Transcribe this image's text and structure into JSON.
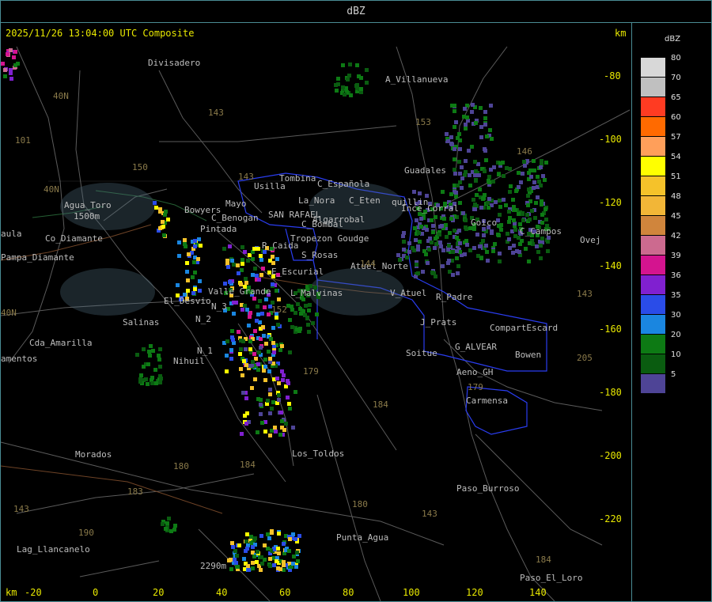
{
  "header": {
    "unit_title": "dBZ",
    "timestamp": "2025/11/26 13:04:00 UTC Composite",
    "km_top": "km",
    "km_bottom": "km"
  },
  "axes": {
    "x_ticks": [
      "-20",
      "0",
      "20",
      "40",
      "60",
      "80",
      "100",
      "120",
      "140"
    ],
    "y_ticks": [
      "-80",
      "-100",
      "-120",
      "-140",
      "-160",
      "-180",
      "-200",
      "-220"
    ]
  },
  "legend": {
    "title": "dBZ",
    "levels": [
      {
        "value": "80",
        "color": "#d8d8d8"
      },
      {
        "value": "70",
        "color": "#c0c0c0"
      },
      {
        "value": "65",
        "color": "#ff3b22"
      },
      {
        "value": "60",
        "color": "#ff6a00"
      },
      {
        "value": "57",
        "color": "#ff9f5a"
      },
      {
        "value": "54",
        "color": "#ffff00"
      },
      {
        "value": "51",
        "color": "#f5c22a"
      },
      {
        "value": "48",
        "color": "#f2b637"
      },
      {
        "value": "45",
        "color": "#d0853c"
      },
      {
        "value": "42",
        "color": "#cc6a8f"
      },
      {
        "value": "39",
        "color": "#d4148f"
      },
      {
        "value": "36",
        "color": "#8020d0"
      },
      {
        "value": "35",
        "color": "#2a4ce8"
      },
      {
        "value": "30",
        "color": "#1a86e0"
      },
      {
        "value": "20",
        "color": "#0d7a14"
      },
      {
        "value": "10",
        "color": "#0a5c10"
      },
      {
        "value": "5",
        "color": "#4e4496"
      }
    ]
  },
  "places": [
    "Divisadero",
    "A_Villanueva",
    "Guadales",
    "Tombina",
    "Usilla",
    "C_Española",
    "La_Nora",
    "C_Eten",
    "quillin",
    "Ince_Corral",
    "Agua_Toro",
    "1500m",
    "Co_Diamante",
    "aula",
    "Pampa_Diamante",
    "Bowyers",
    "Mayo",
    "C_Benogan",
    "SAN RAFAEL",
    "Algarrobal",
    "Pintada",
    "C_Bombal",
    "Tropezon Goudge",
    "R_Caida",
    "S_Rosas",
    "Atuel_Norte",
    "E_Escurial",
    "Valle_Grande",
    "El_Desvio",
    "L_Malvinas",
    "V_Atuel",
    "R_Padre",
    "Salinas",
    "N_3",
    "N_2",
    "J_Prats",
    "CompartEscard",
    "Cda_Amarilla",
    "amentos",
    "N_1",
    "Nihuil",
    "G_ALVEAR",
    "Soitue",
    "Bowen",
    "Aeno_GH",
    "Carmensa",
    "Morados",
    "Los_Toldos",
    "Paso_Burroso",
    "Punta_Agua",
    "Lag_Llancanelo",
    "2290m",
    "Paso_El_Loro",
    "Goico",
    "C_Campos",
    "Ovej",
    "40N",
    "40N",
    "40N",
    "101",
    "143",
    "153",
    "150",
    "146",
    "143",
    "144",
    "152",
    "179",
    "184",
    "180",
    "184",
    "183",
    "190",
    "143",
    "179",
    "180",
    "143",
    "205",
    "143",
    "184"
  ]
}
